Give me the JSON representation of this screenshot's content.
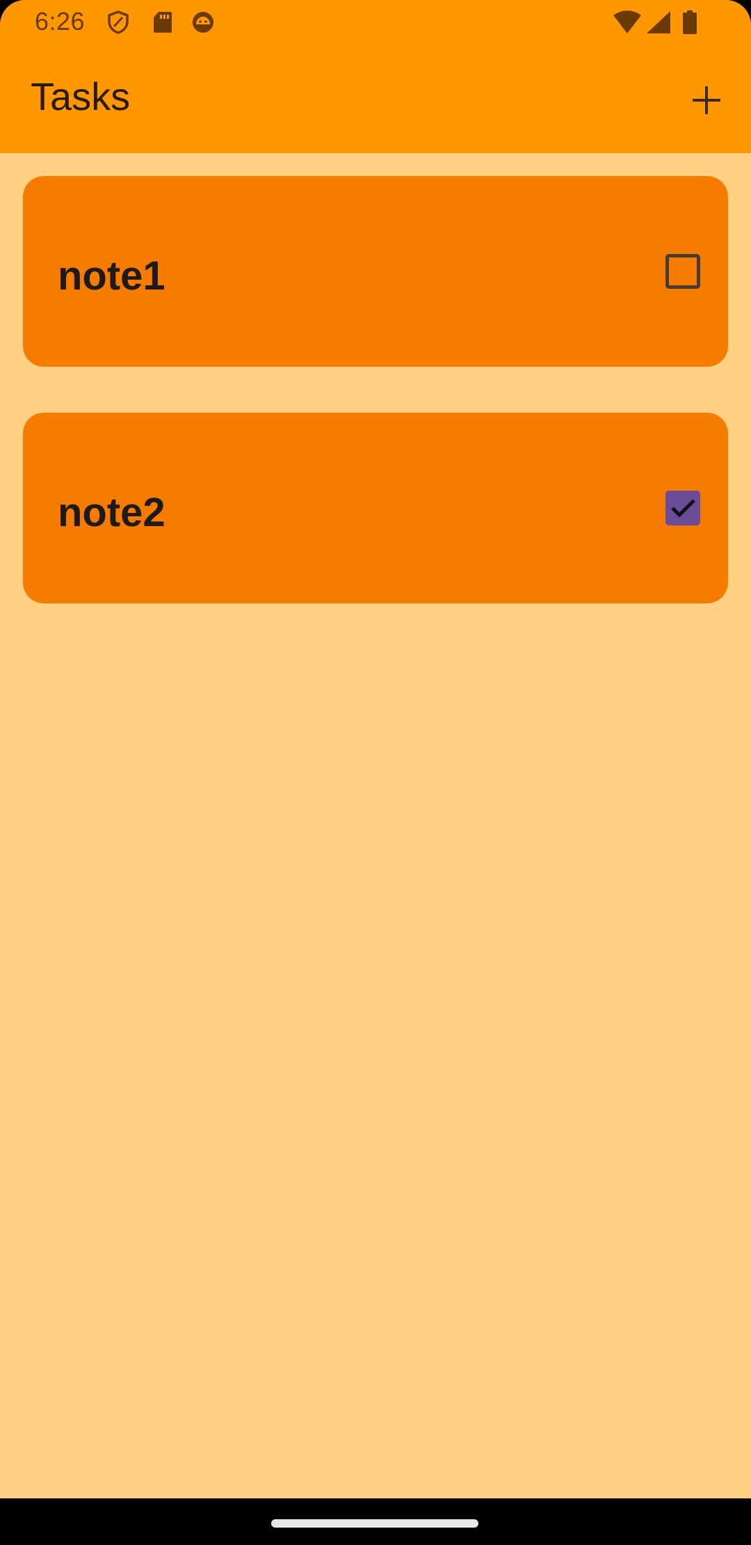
{
  "status_bar": {
    "time": "6:26",
    "icons": [
      "shield-icon",
      "sd-card-icon",
      "android-face-icon",
      "wifi-icon",
      "cellular-signal-icon",
      "battery-icon"
    ]
  },
  "app_bar": {
    "title": "Tasks",
    "add_icon": "plus-icon"
  },
  "tasks": [
    {
      "title": "note1",
      "checked": false
    },
    {
      "title": "note2",
      "checked": true
    }
  ],
  "colors": {
    "app_bar": "#FF9800",
    "background": "#FFD180",
    "card": "#F57C00",
    "checkbox_checked": "#6B4C9A",
    "status_icon": "#6B3A00"
  }
}
